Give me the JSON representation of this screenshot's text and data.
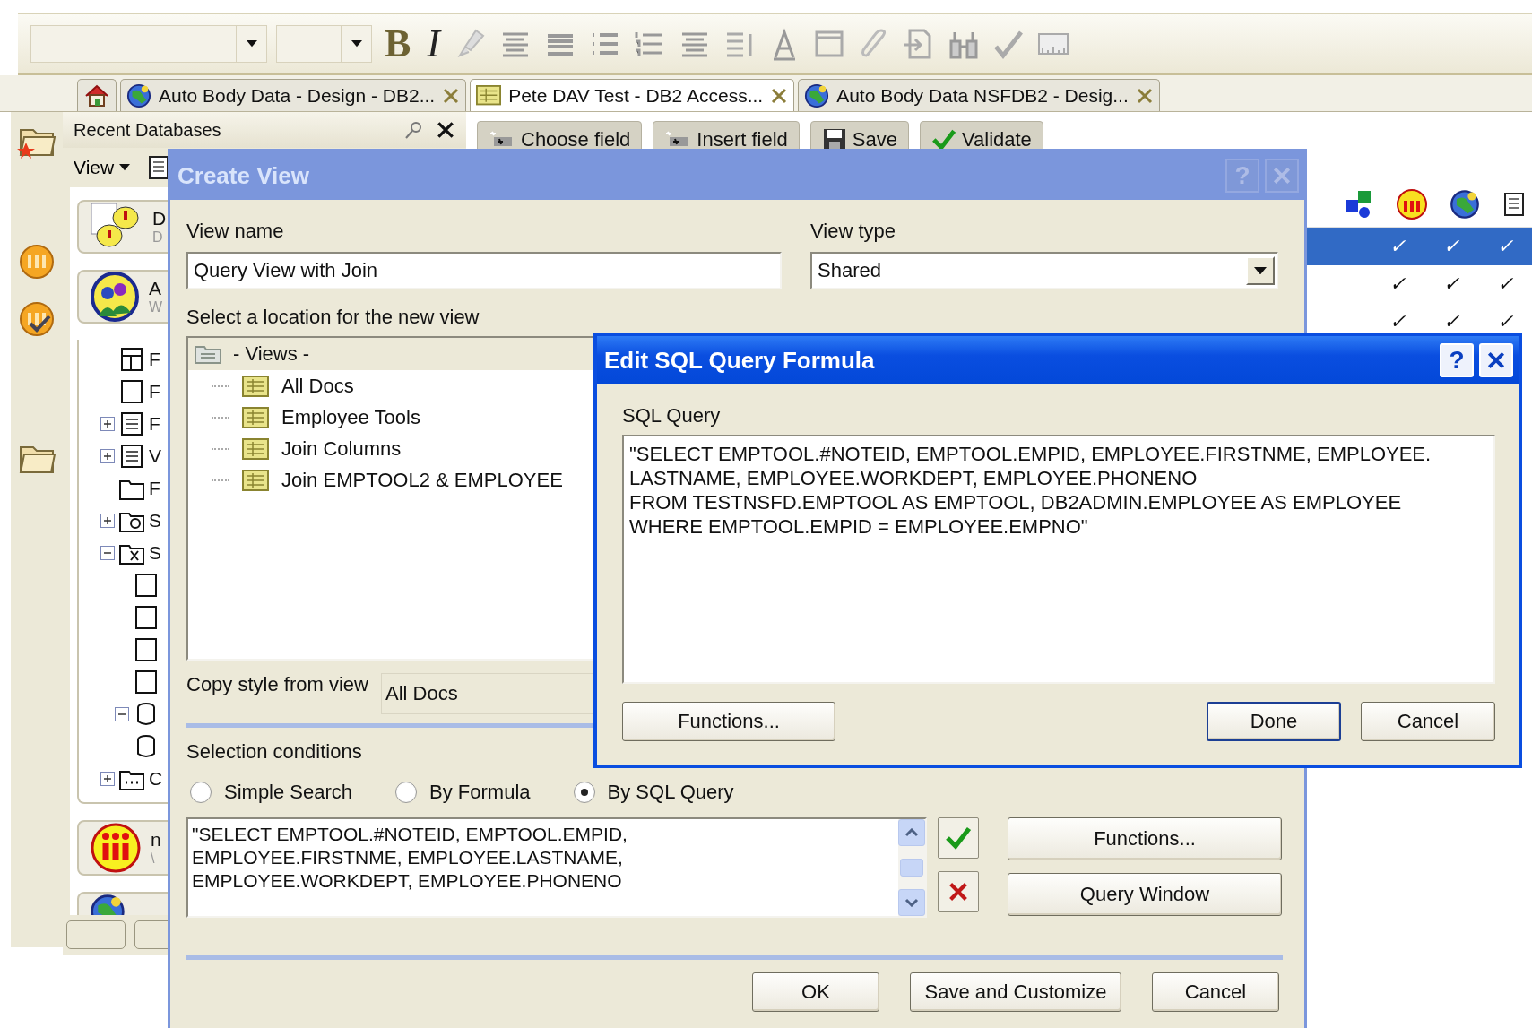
{
  "toolbar": {
    "glyph_buttons": [
      {
        "kind": "bold",
        "label": "B"
      },
      {
        "kind": "italic",
        "label": "I"
      }
    ]
  },
  "tabs": [
    {
      "kind": "home",
      "selected": false
    },
    {
      "kind": "database",
      "label": "Auto Body Data - Design - DB2...",
      "selected": false
    },
    {
      "kind": "design",
      "label": "Pete DAV Test - DB2 Access...",
      "selected": true
    },
    {
      "kind": "database",
      "label": "Auto Body Data NSFDB2 - Desig...",
      "selected": false
    }
  ],
  "recent_panel": {
    "title": "Recent Databases",
    "view_menu": "View",
    "cards_top": [
      {
        "kind": "notes",
        "title": "D",
        "subtitle": "D"
      },
      {
        "kind": "people",
        "title": "A",
        "subtitle": "W"
      }
    ],
    "tree": [
      {
        "kind": "layout",
        "label": "F"
      },
      {
        "kind": "page",
        "label": "F"
      },
      {
        "kind": "form",
        "label": "F",
        "expanded": false
      },
      {
        "kind": "view",
        "label": "V",
        "expanded": false
      },
      {
        "kind": "folder",
        "label": "F"
      },
      {
        "kind": "search",
        "label": "S",
        "expanded": false
      },
      {
        "kind": "tools",
        "label": "S",
        "expanded": true,
        "children": [
          {
            "kind": "script"
          },
          {
            "kind": "agent"
          },
          {
            "kind": "applet"
          },
          {
            "kind": "file"
          },
          {
            "kind": "db",
            "expanded": true,
            "children": [
              {
                "kind": "column"
              }
            ]
          }
        ]
      },
      {
        "kind": "dots",
        "label": "C",
        "expanded": false
      }
    ],
    "cards_bottom": [
      {
        "kind": "logo",
        "title": "n",
        "subtitle": "\\"
      }
    ]
  },
  "actions": [
    {
      "kind": "field",
      "label": "Choose field"
    },
    {
      "kind": "field",
      "label": "Insert field"
    },
    {
      "kind": "save",
      "label": "Save"
    },
    {
      "kind": "validate",
      "label": "Validate"
    }
  ],
  "view_rows": [
    {
      "selected": true,
      "cells": [
        "✓",
        "✓",
        "✓"
      ]
    },
    {
      "selected": false,
      "cells": [
        "✓",
        "✓",
        "✓"
      ]
    },
    {
      "selected": false,
      "cells": [
        "✓",
        "✓",
        "✓"
      ]
    }
  ],
  "create_view": {
    "title": "Create View",
    "active": false,
    "help": "?",
    "view_name_label": "View name",
    "view_name": "Query View with Join",
    "view_type_label": "View type",
    "view_type": "Shared",
    "location_label": "Select a location for the new view",
    "locations": {
      "label": "- Views -",
      "children": [
        {
          "label": "All Docs"
        },
        {
          "label": "Employee Tools"
        },
        {
          "label": "Join Columns"
        },
        {
          "label": "Join EMPTOOL2 & EMPLOYEE"
        }
      ]
    },
    "copy_style_label": "Copy style from view",
    "copy_style": "All Docs",
    "selection_label": "Selection conditions",
    "conditions": [
      {
        "label": "Simple Search",
        "selected": false
      },
      {
        "label": "By Formula",
        "selected": false
      },
      {
        "label": "By SQL Query",
        "selected": true
      }
    ],
    "formula_lines": [
      "\"SELECT EMPTOOL.#NOTEID, EMPTOOL.EMPID,",
      "EMPLOYEE.FIRSTNME, EMPLOYEE.LASTNAME,",
      "EMPLOYEE.WORKDEPT, EMPLOYEE.PHONENO"
    ],
    "side_buttons": [
      "Functions...",
      "Query Window"
    ],
    "buttons": [
      "OK",
      "Save and Customize",
      "Cancel"
    ]
  },
  "edit_sql": {
    "title": "Edit SQL Query Formula",
    "active": true,
    "help": "?",
    "query_label": "SQL Query",
    "query_lines": [
      "\"SELECT EMPTOOL.#NOTEID, EMPTOOL.EMPID, EMPLOYEE.FIRSTNME, EMPLOYEE.",
      "LASTNAME, EMPLOYEE.WORKDEPT, EMPLOYEE.PHONENO",
      "FROM TESTNSFD.EMPTOOL AS EMPTOOL, DB2ADMIN.EMPLOYEE AS EMPLOYEE",
      "WHERE EMPTOOL.EMPID = EMPLOYEE.EMPNO\""
    ],
    "buttons": [
      {
        "label": "Functions...",
        "default": false
      },
      {
        "label": "Done",
        "default": true
      },
      {
        "label": "Cancel",
        "default": false
      }
    ]
  }
}
